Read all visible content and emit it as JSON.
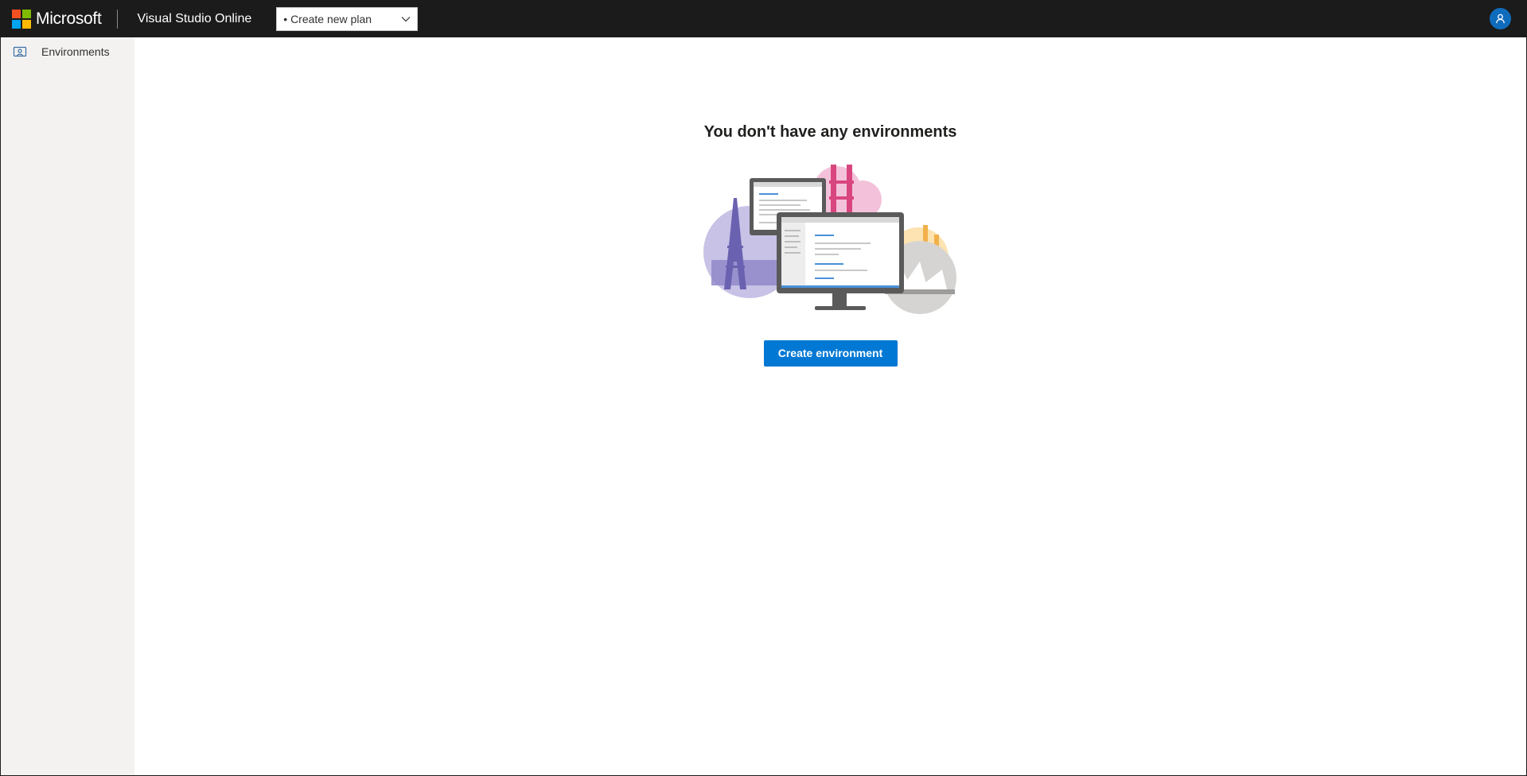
{
  "header": {
    "brand": "Microsoft",
    "product": "Visual Studio Online",
    "plan_select": {
      "value": "• Create new plan",
      "icon": "chevron-down-icon"
    },
    "avatar_icon": "person-icon"
  },
  "sidebar": {
    "items": [
      {
        "label": "Environments",
        "icon": "environments-icon"
      }
    ]
  },
  "main": {
    "empty_title": "You don't have any environments",
    "illustration": "world-landmarks-monitors-illustration",
    "cta_label": "Create environment"
  },
  "colors": {
    "topbar": "#1b1b1b",
    "sidebar": "#f3f2f1",
    "accent": "#0078d4",
    "ms_red": "#f25022",
    "ms_green": "#7fba00",
    "ms_blue": "#00a4ef",
    "ms_yellow": "#ffb900"
  }
}
